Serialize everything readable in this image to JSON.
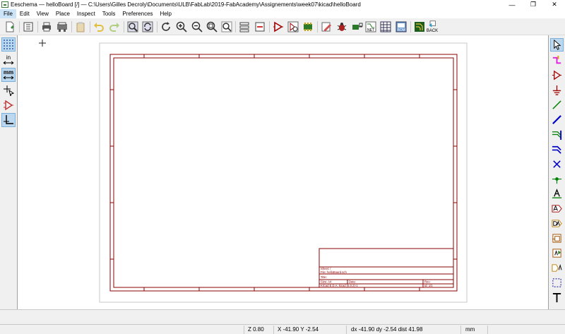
{
  "window": {
    "title": "Eeschema — helloBoard [/] — C:\\Users\\Gilles Decroly\\Documents\\ULB\\FabLab\\2019-FabAcademy\\Assignements\\week07\\kicad\\helloBoard",
    "minimize": "—",
    "restore": "❐",
    "close": "✕"
  },
  "menu": [
    "File",
    "Edit",
    "View",
    "Place",
    "Inspect",
    "Tools",
    "Preferences",
    "Help"
  ],
  "toolbar": {
    "back_label": "BACK",
    "net_label": "NET",
    "bom_label": "BOM"
  },
  "left_toolbar": {
    "units_in": "in",
    "units_mm": "mm"
  },
  "title_block": {
    "sheet": "Sheet: /",
    "file": "File: helloBoard.sch",
    "title": "Title:",
    "size": "Size: A4",
    "date": "Date:",
    "rev": "Rev:",
    "kicad": "KiCad E.D.A.  kicad (5.0.2)-1",
    "id": "Id: 1/1"
  },
  "status": {
    "zoom": "Z 0.80",
    "coords": "X -41.90  Y -2.54",
    "delta": "dx -41.90  dy -2.54  dist 41.98",
    "units": "mm"
  },
  "colors": {
    "sheet_border": "#8b0000",
    "accent_blue": "#1e5faa",
    "wire_green": "#008000",
    "bus_blue": "#0000c8"
  }
}
